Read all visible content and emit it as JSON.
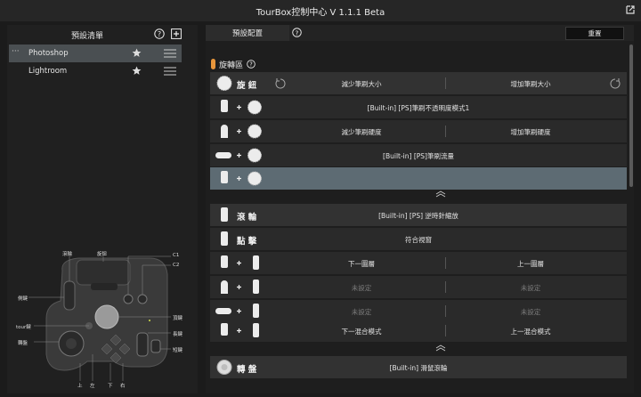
{
  "window": {
    "title": "TourBox控制中心 V 1.1.1 Beta",
    "external_icon": "external-link-icon"
  },
  "left_panel": {
    "title": "預設清單",
    "presets": [
      {
        "name": "Photoshop",
        "active": true
      },
      {
        "name": "Lightroom",
        "active": false
      }
    ],
    "device_labels": {
      "scroll": "滾輪",
      "knob": "旋鈕",
      "c1": "C1",
      "c2": "C2",
      "side": "側鍵",
      "tour": "tour鍵",
      "dial": "轉盤",
      "top": "頂鍵",
      "tall": "長鍵",
      "short": "短鍵",
      "up": "上",
      "left": "左",
      "down": "下",
      "right": "右"
    }
  },
  "right_panel": {
    "tab_label": "預設配置",
    "reset_label": "重置",
    "section_title": "旋轉區",
    "rows": [
      {
        "id": "knob",
        "label": "旋 鈕",
        "left": "減少筆刷大小",
        "right": "增加筆刷大小"
      },
      {
        "id": "side-knob",
        "center": "[Built-in] [PS]筆刷不透明度模式1"
      },
      {
        "id": "top-knob",
        "left": "減少筆刷硬度",
        "right": "增加筆刷硬度"
      },
      {
        "id": "tall-knob",
        "center": "[Built-in] [PS]筆刷流量"
      },
      {
        "id": "short-knob",
        "left": "",
        "right": ""
      },
      {
        "id": "scroll",
        "label": "滾 輪",
        "center": "[Built-in] [PS] 逆時針縮放"
      },
      {
        "id": "click",
        "label": "點 擊",
        "center": "符合視窗"
      },
      {
        "id": "side-scroll",
        "left": "下一圖層",
        "right": "上一圖層"
      },
      {
        "id": "top-scroll",
        "left": "未設定",
        "right": "未設定"
      },
      {
        "id": "tall-scroll",
        "left": "未設定",
        "right": "未設定"
      },
      {
        "id": "short-scroll",
        "left": "下一混合模式",
        "right": "上一混合模式"
      },
      {
        "id": "dial",
        "label": "轉 盤",
        "center": "[Built-in] 滑鼠滾輪"
      }
    ],
    "colors": {
      "accent": "#e8963b",
      "selected_row": "#5d6b73"
    }
  }
}
